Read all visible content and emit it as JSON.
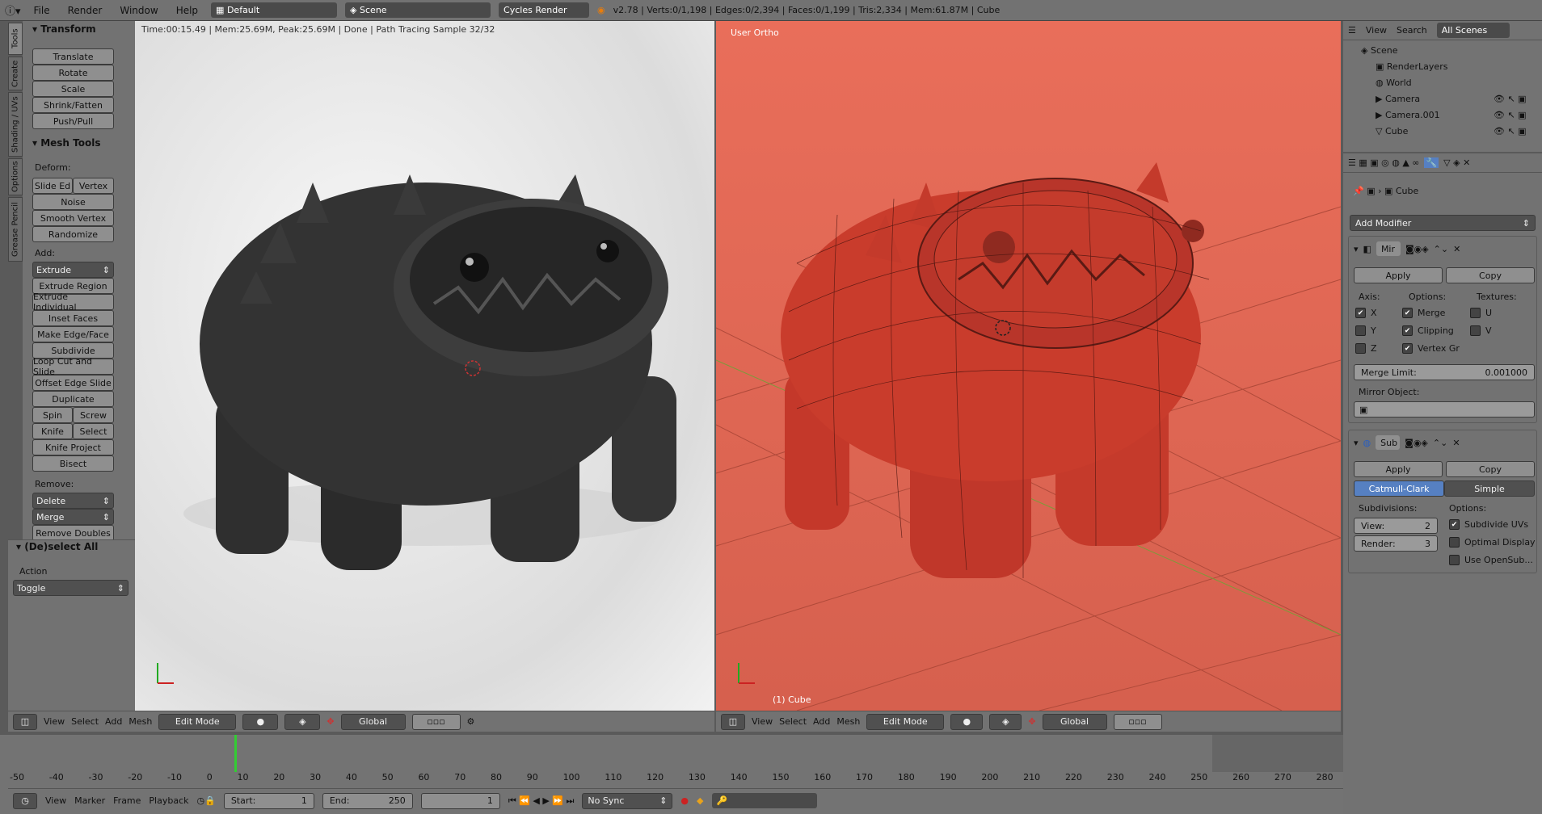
{
  "topbar": {
    "info_icon": "info-icon",
    "menus": [
      "File",
      "Render",
      "Window",
      "Help"
    ],
    "layout": "Default",
    "scene": "Scene",
    "engine": "Cycles Render",
    "stats": "v2.78 | Verts:0/1,198 | Edges:0/2,394 | Faces:0/1,199 | Tris:2,334 | Mem:61.87M | Cube"
  },
  "tabs": [
    "Tools",
    "Create",
    "Shading / UVs",
    "Options",
    "Grease Pencil"
  ],
  "toolshelf": {
    "transform_title": "Transform",
    "transform": [
      "Translate",
      "Rotate",
      "Scale",
      "Shrink/Fatten",
      "Push/Pull"
    ],
    "mesh_tools_title": "Mesh Tools",
    "deform_label": "Deform:",
    "deform_pair": [
      "Slide Ed",
      "Vertex"
    ],
    "deform": [
      "Noise",
      "Smooth Vertex",
      "Randomize"
    ],
    "add_label": "Add:",
    "extrude": "Extrude",
    "add": [
      "Extrude Region",
      "Extrude Individual",
      "Inset Faces",
      "Make Edge/Face",
      "Subdivide",
      "Loop Cut and Slide",
      "Offset Edge Slide",
      "Duplicate"
    ],
    "pairs": [
      [
        "Spin",
        "Screw"
      ],
      [
        "Knife",
        "Select"
      ]
    ],
    "add_more": [
      "Knife Project",
      "Bisect"
    ],
    "remove_label": "Remove:",
    "delete": "Delete",
    "merge": "Merge",
    "remove_doubles": "Remove Doubles",
    "deselect_title": "(De)select All",
    "action_label": "Action",
    "action_value": "Toggle"
  },
  "viewport_left": {
    "status": "Time:00:15.49 | Mem:25.69M, Peak:25.69M | Done | Path Tracing Sample 32/32"
  },
  "viewport_right": {
    "view_label": "User Ortho",
    "object_label": "(1) Cube"
  },
  "header3d": {
    "menus": [
      "View",
      "Select",
      "Add",
      "Mesh"
    ],
    "mode": "Edit Mode",
    "orientation": "Global"
  },
  "outliner": {
    "menus": [
      "View",
      "Search"
    ],
    "filter": "All Scenes",
    "items": [
      "Scene",
      "RenderLayers",
      "World",
      "Camera",
      "Camera.001",
      "Cube"
    ]
  },
  "properties": {
    "breadcrumb": "Cube",
    "add_modifier": "Add Modifier",
    "mirror": {
      "name": "Mir",
      "apply": "Apply",
      "copy": "Copy",
      "axis_label": "Axis:",
      "options_label": "Options:",
      "textures_label": "Textures:",
      "axes": [
        "X",
        "Y",
        "Z"
      ],
      "options": [
        "Merge",
        "Clipping",
        "Vertex Gr"
      ],
      "textures": [
        "U",
        "V"
      ],
      "merge_limit_label": "Merge Limit:",
      "merge_limit": "0.001000",
      "mirror_object_label": "Mirror Object:"
    },
    "subsurf": {
      "name": "Sub",
      "apply": "Apply",
      "copy": "Copy",
      "catmull": "Catmull-Clark",
      "simple": "Simple",
      "subdivisions_label": "Subdivisions:",
      "options_label": "Options:",
      "view_label": "View:",
      "view_value": "2",
      "render_label": "Render:",
      "render_value": "3",
      "options": [
        "Subdivide UVs",
        "Optimal Display",
        "Use OpenSub..."
      ]
    }
  },
  "timeline": {
    "ticks": [
      "-50",
      "-40",
      "-30",
      "-20",
      "-10",
      "0",
      "10",
      "20",
      "30",
      "40",
      "50",
      "60",
      "70",
      "80",
      "90",
      "100",
      "110",
      "120",
      "130",
      "140",
      "150",
      "160",
      "170",
      "180",
      "190",
      "200",
      "210",
      "220",
      "230",
      "240",
      "250",
      "260",
      "270",
      "280"
    ],
    "menus": [
      "View",
      "Marker",
      "Frame",
      "Playback"
    ],
    "start_label": "Start:",
    "start": "1",
    "end_label": "End:",
    "end": "250",
    "current": "1",
    "sync": "No Sync"
  },
  "colors": {
    "render_bg": "#efefef",
    "mesh_bg": "#e06a56",
    "highlight": "#5680c2",
    "keyframe_line": "#33cc33"
  }
}
